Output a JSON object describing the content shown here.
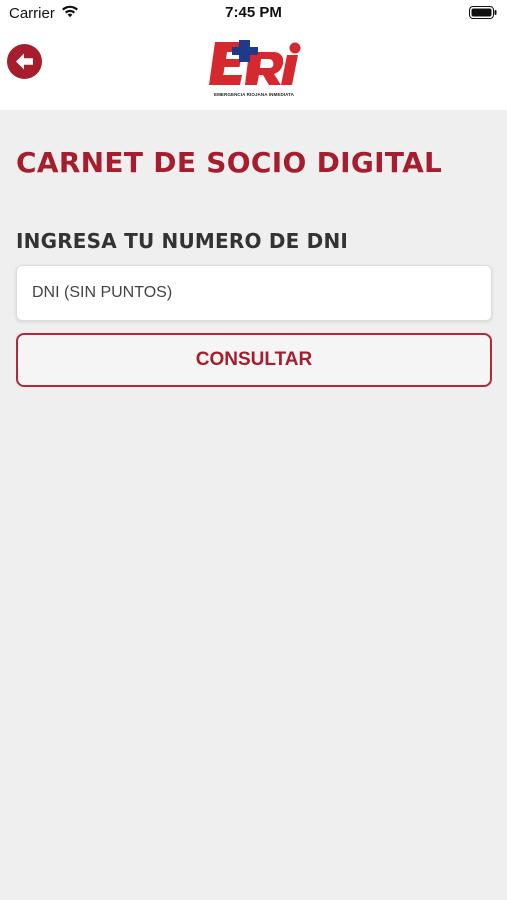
{
  "status_bar": {
    "carrier": "Carrier",
    "time": "7:45 PM",
    "icons": [
      "wifi-icon",
      "battery-icon"
    ]
  },
  "header": {
    "back_icon": "arrow-left-icon",
    "logo_text": "ERI",
    "logo_tagline": "EMERGENCIA RIOJANA INMEDIATA"
  },
  "main": {
    "title": "CARNET DE SOCIO DIGITAL",
    "dni_label": "INGRESA TU NUMERO DE DNI",
    "dni_input": {
      "value": "",
      "placeholder": "DNI (SIN PUNTOS)"
    },
    "consult_button_label": "CONSULTAR"
  },
  "colors": {
    "brand_red": "#a61d2e",
    "logo_blue": "#1f3a8a",
    "background": "#efefef"
  }
}
